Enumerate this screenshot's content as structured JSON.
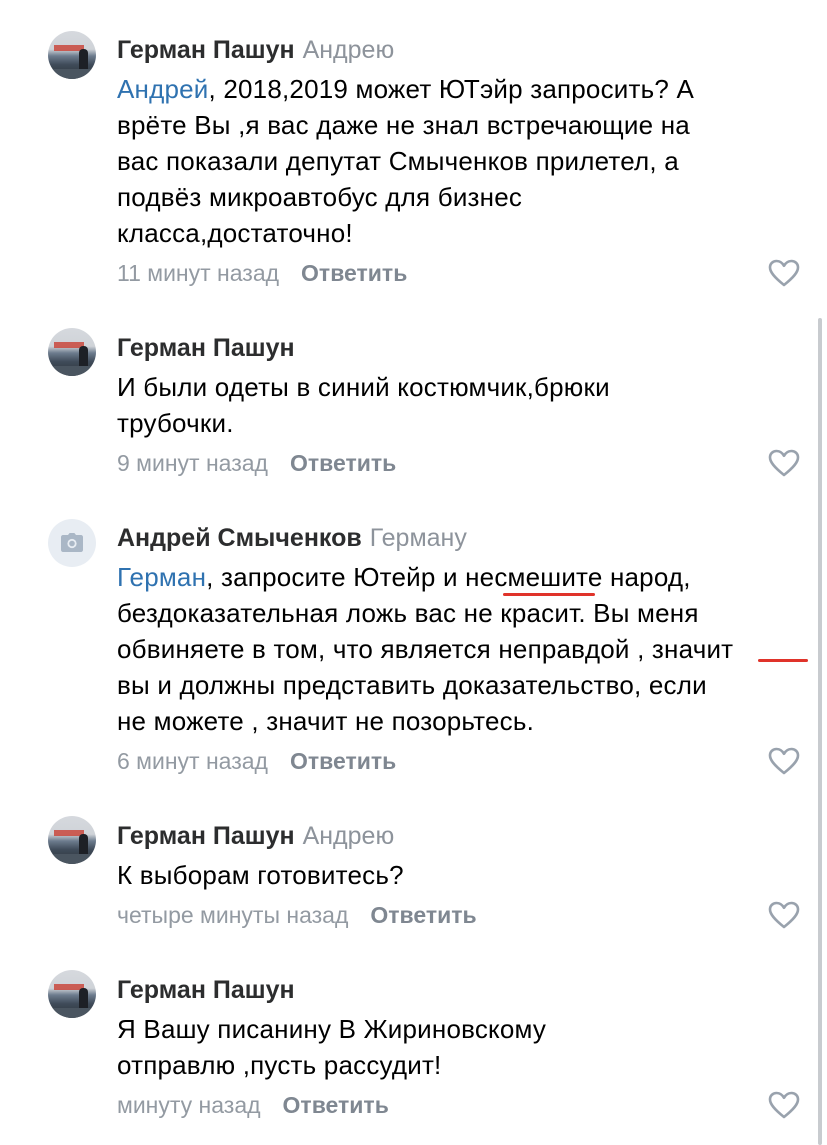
{
  "comments": [
    {
      "author": "Герман Пашун",
      "reply_to": "Андрею",
      "mention": "Андрей",
      "lines_first_rest": ", 2018,2019 может ЮТэйр запросить? А",
      "lines": [
        "врёте Вы ,я вас даже не знал  встречающие на",
        "вас показали депутат Смыченков прилетел, а",
        "подвёз микроавтобус для бизнес",
        "класса,достаточно!"
      ],
      "time": "11 минут назад",
      "reply_label": "Ответить",
      "like_icon": "heart-outline"
    },
    {
      "author": "Герман Пашун",
      "lines": [
        "И были одеты в синий костюмчик,брюки",
        "трубочки."
      ],
      "time": "9 минут назад",
      "reply_label": "Ответить",
      "like_icon": "heart-outline"
    },
    {
      "author": "Андрей Смыченков",
      "reply_to": "Герману",
      "mention": "Герман",
      "lines_first_rest": ", запросите Ютейр и несмешите народ,",
      "lines": [
        "бездоказательная ложь вас не красит. Вы меня",
        "обвиняете в том, что является неправдой , значит",
        "вы и должны представить доказательство, если",
        "не можете , значит не позорьтесь."
      ],
      "time": "6 минут назад",
      "reply_label": "Ответить",
      "like_icon": "heart-outline",
      "avatar_icon": "camera-icon"
    },
    {
      "author": "Герман Пашун",
      "reply_to": "Андрею",
      "lines": [
        "К выборам готовитесь?"
      ],
      "time": "четыре минуты назад",
      "reply_label": "Ответить",
      "like_icon": "heart-outline"
    },
    {
      "author": "Герман Пашун",
      "lines": [
        "Я Вашу писанину В Жириновскому",
        "отправлю ,пусть рассудит!"
      ],
      "time": "минуту назад",
      "reply_label": "Ответить",
      "like_icon": "heart-outline"
    }
  ],
  "colors": {
    "mention": "#2f72b0",
    "author": "#2c2d2e",
    "secondary": "#8d939b",
    "annotation": "#e0332a"
  }
}
